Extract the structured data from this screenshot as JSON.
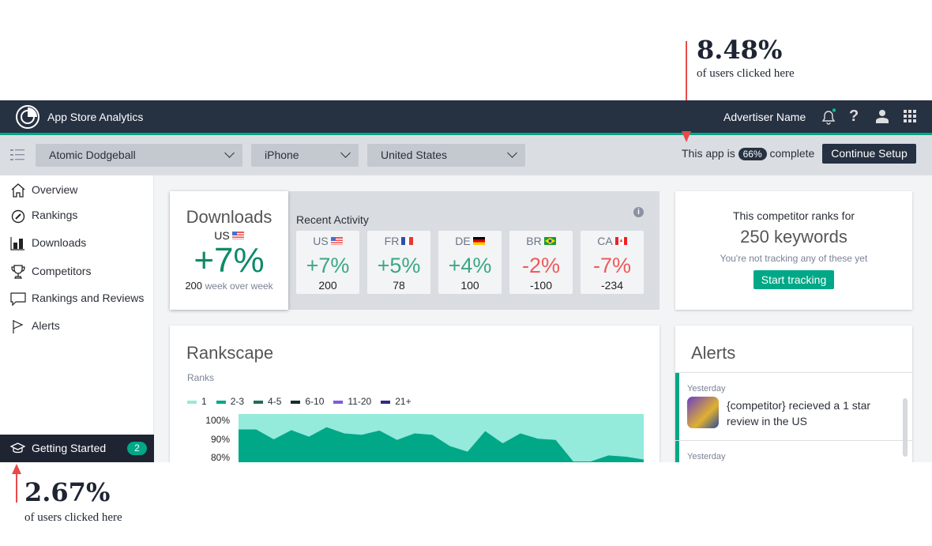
{
  "annotations": [
    {
      "value": "8.48%",
      "caption": "of users clicked here",
      "target": "continue-setup"
    },
    {
      "value": "2.67%",
      "caption": "of users clicked here",
      "target": "getting-started"
    }
  ],
  "header": {
    "app_title": "App Store Analytics",
    "user_name": "Advertiser Name",
    "icons": [
      "bell-icon",
      "help-icon",
      "user-icon",
      "apps-grid-icon"
    ],
    "notification_dot": true
  },
  "toolbar": {
    "app_select": "Atomic Dodgeball",
    "device_select": "iPhone",
    "country_select": "United States",
    "progress_prefix": "This app is",
    "progress_value": "66%",
    "progress_suffix": "complete",
    "progress_fraction": 0.66,
    "continue_label": "Continue Setup"
  },
  "sidebar": {
    "items": [
      {
        "label": "Overview",
        "icon": "home-icon"
      },
      {
        "label": "Rankings",
        "icon": "gauge-icon"
      },
      {
        "label": "Downloads",
        "icon": "bar-chart-icon"
      },
      {
        "label": "Competitors",
        "icon": "trophy-icon"
      },
      {
        "label": "Rankings and Reviews",
        "icon": "speech-bubble-icon"
      },
      {
        "label": "Alerts",
        "icon": "flag-icon"
      }
    ],
    "getting_started": {
      "label": "Getting Started",
      "count": "2"
    }
  },
  "downloads": {
    "title": "Downloads",
    "country": "US",
    "change": "+7%",
    "count": "200",
    "period": "week over week"
  },
  "recent_activity": {
    "title": "Recent Activity",
    "countries": [
      {
        "code": "US",
        "change": "+7%",
        "value": "200",
        "trend": "up"
      },
      {
        "code": "FR",
        "change": "+5%",
        "value": "78",
        "trend": "up"
      },
      {
        "code": "DE",
        "change": "+4%",
        "value": "100",
        "trend": "up"
      },
      {
        "code": "BR",
        "change": "-2%",
        "value": "-100",
        "trend": "down"
      },
      {
        "code": "CA",
        "change": "-7%",
        "value": "-234",
        "trend": "down"
      }
    ]
  },
  "competitor": {
    "line1": "This competitor ranks for",
    "keywords": "250 keywords",
    "note": "You're not tracking any of these yet",
    "button": "Start tracking"
  },
  "alerts": {
    "title": "Alerts",
    "items": [
      {
        "date": "Yesterday",
        "text": "{competitor} recieved a 1 star review in the US"
      },
      {
        "date": "Yesterday",
        "text": ""
      }
    ]
  },
  "rankscape": {
    "title": "Rankscape",
    "subtitle": "Ranks"
  },
  "colors": {
    "accent": "#00a887",
    "header": "#263142",
    "positive": "#3aa883",
    "negative": "#ef5a5a",
    "annotation_arrow": "#e84a4a"
  },
  "chart_data": {
    "type": "area",
    "title": "Rankscape",
    "ylabel": "Ranks",
    "yticks": [
      "100%",
      "90%",
      "80%"
    ],
    "legend": [
      {
        "name": "1",
        "color": "#94eadb"
      },
      {
        "name": "2-3",
        "color": "#00a887"
      },
      {
        "name": "4-5",
        "color": "#226b5c"
      },
      {
        "name": "6-10",
        "color": "#12302b"
      },
      {
        "name": "11-20",
        "color": "#7c5cdc"
      },
      {
        "name": "21+",
        "color": "#34288a"
      }
    ],
    "legend_placement": "top-left",
    "series": [
      {
        "name": "1",
        "values": [
          100,
          100,
          100,
          100,
          100,
          100,
          100,
          100,
          100,
          100,
          100,
          100,
          100,
          100,
          100,
          100,
          100,
          100,
          100,
          100,
          100,
          100,
          100,
          100
        ]
      },
      {
        "name": "2-3",
        "values": [
          94.8,
          94.8,
          89.6,
          94.4,
          91,
          96,
          92.7,
          92,
          94.2,
          89.3,
          92.7,
          92,
          86,
          83.1,
          93.9,
          87.5,
          92.7,
          89.9,
          89.3,
          77.9,
          77.9,
          81.1,
          80.4,
          78.9
        ]
      }
    ]
  }
}
